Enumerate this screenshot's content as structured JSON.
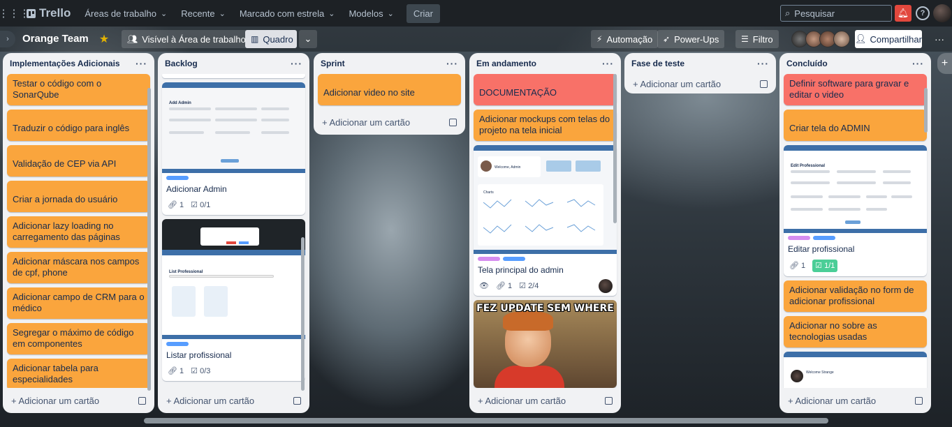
{
  "topbar": {
    "brand": "Trello",
    "menus": [
      "Áreas de trabalho",
      "Recente",
      "Marcado com estrela",
      "Modelos"
    ],
    "create": "Criar",
    "search_placeholder": "Pesquisar"
  },
  "board": {
    "name": "Orange Team",
    "visibility": "Visível à Área de trabalho",
    "view": "Quadro",
    "automation": "Automação",
    "powerups": "Power-Ups",
    "filter": "Filtro",
    "share": "Compartilhar"
  },
  "colors": {
    "orange": "#faa53d",
    "red": "#f87168",
    "label_blue": "#579dff",
    "label_purple": "#d68df0",
    "done_green": "#4bce97"
  },
  "lists": [
    {
      "title": "Implementações Adicionais",
      "add": "Adicionar um cartão",
      "cards": [
        "Testar o código com o SonarQube",
        "Traduzir o código para inglês",
        "Validação de CEP via API",
        "Criar a jornada do usuário",
        "Adicionar lazy loading no carregamento das páginas",
        "Adicionar máscara nos campos de cpf, phone",
        "Adicionar campo de CRM para o médico",
        "Segregar o máximo de código em componentes",
        "Adicionar tabela para especialidades"
      ]
    },
    {
      "title": "Backlog",
      "add": "Adicionar um cartão",
      "cards": [
        {
          "title": "Adicionar Admin",
          "attachments": "1",
          "checklist": "0/1"
        },
        {
          "title": "Listar profissional",
          "attachments": "1",
          "checklist": "0/3"
        }
      ]
    },
    {
      "title": "Sprint",
      "add": "Adicionar um cartão",
      "cards": [
        "Adicionar video no site"
      ]
    },
    {
      "title": "Em andamento",
      "add": "Adicionar um cartão",
      "cards": [
        "DOCUMENTAÇÃO",
        "Adicionar mockups com telas do projeto na tela inicial",
        {
          "title": "Tela principal do admin",
          "attachments": "1",
          "checklist": "2/4"
        },
        {
          "meme": "FEZ UPDATE SEM WHERE"
        }
      ]
    },
    {
      "title": "Fase de teste",
      "add": "Adicionar um cartão",
      "cards": []
    },
    {
      "title": "Concluído",
      "add": "Adicionar um cartão",
      "cards": [
        "Definir software para gravar e editar o video",
        "Criar tela do ADMIN",
        {
          "title": "Editar profissional",
          "attachments": "1",
          "checklist": "1/1"
        },
        "Adicionar validação no form de adicionar profissional",
        "Adicionar no sobre as tecnologias usadas"
      ]
    }
  ],
  "mockups": {
    "add_admin": "Add Admin",
    "list_professional": "List Professional",
    "welcome_admin": "Welcome, Admin",
    "charts": "Charts",
    "edit_professional": "Edit Professional",
    "welcome_strange": "Welcome Strange"
  }
}
